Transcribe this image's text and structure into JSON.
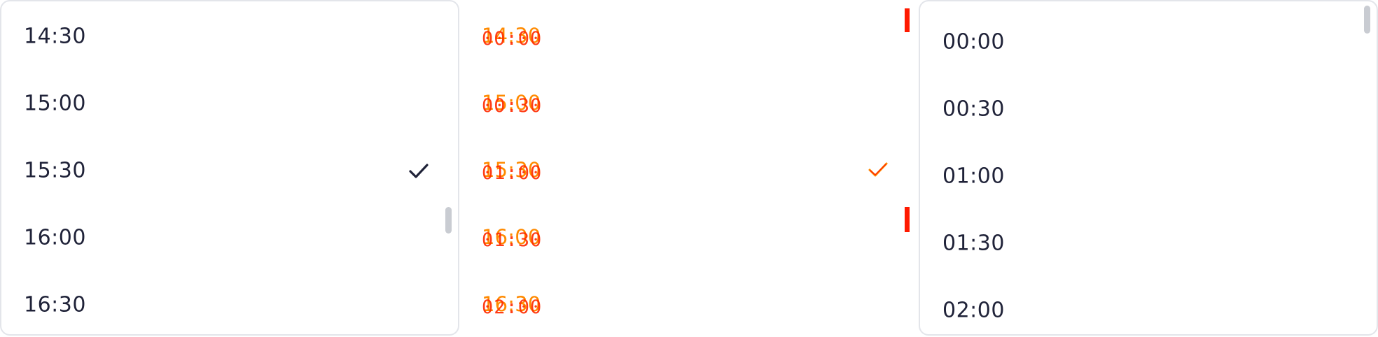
{
  "left_list": {
    "items": [
      "14:30",
      "15:00",
      "15:30",
      "16:00",
      "16:30"
    ],
    "selected": "15:30",
    "colors": {
      "text": "#1f2238",
      "check": "#1f2238",
      "border": "#e3e5ea",
      "scrollbar": "#c9ccd2"
    },
    "check_icon": "check-icon"
  },
  "mid_diff": {
    "items_a": [
      "14:30",
      "15:00",
      "15:30",
      "16:00",
      "16:30"
    ],
    "items_b": [
      "00:00",
      "00:30",
      "01:00",
      "01:30",
      "02:00"
    ],
    "colors": {
      "a": "#ff8a00",
      "b": "#ff2a00",
      "marker": "#ff1a00"
    },
    "check_icon": "check-icon"
  },
  "right_list": {
    "items": [
      "00:00",
      "00:30",
      "01:00",
      "01:30",
      "02:00"
    ],
    "colors": {
      "text": "#1f2238",
      "border": "#e3e5ea",
      "scrollbar": "#c9ccd2"
    }
  }
}
